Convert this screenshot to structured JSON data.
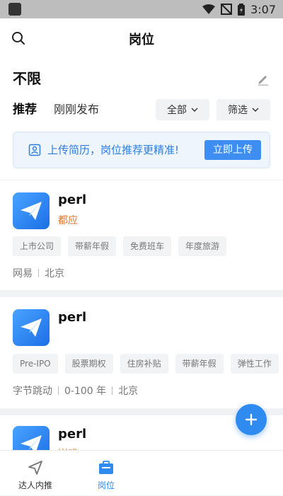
{
  "status_bar": {
    "time": "3:07"
  },
  "header": {
    "title": "岗位",
    "search_icon": "search-icon"
  },
  "filters": {
    "location_label": "不限",
    "tabs": [
      {
        "label": "推荐",
        "active": true
      },
      {
        "label": "刚刚发布",
        "active": false
      }
    ],
    "dropdowns": [
      {
        "label": "全部"
      },
      {
        "label": "筛选"
      }
    ]
  },
  "upload_banner": {
    "text": "上传简历，岗位推荐更精准!",
    "button": "立即上传"
  },
  "jobs": [
    {
      "title": "perl",
      "subtitle": "都应",
      "tags": [
        "上市公司",
        "带薪年假",
        "免费班车",
        "年度旅游"
      ],
      "meta": [
        "网易",
        "北京"
      ]
    },
    {
      "title": "perl",
      "subtitle": "",
      "tags": [
        "Pre-IPO",
        "股票期权",
        "住房补贴",
        "带薪年假",
        "弹性工作"
      ],
      "meta": [
        "字节跳动",
        "0-100 年",
        "北京"
      ]
    },
    {
      "title": "perl",
      "subtitle": "岗戏"
    }
  ],
  "bottom_nav": [
    {
      "label": "达人内推",
      "active": false
    },
    {
      "label": "岗位",
      "active": true
    }
  ],
  "colors": {
    "accent": "#2f8bf0",
    "orange": "#e0722a",
    "banner_text": "#2f7de1"
  }
}
